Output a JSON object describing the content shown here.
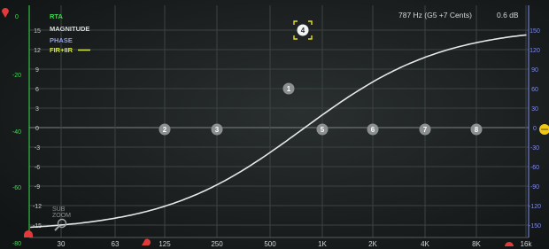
{
  "readout": {
    "frequency": "787 Hz (G5 +7 Cents)",
    "gain": "0.6 dB"
  },
  "legend": [
    {
      "label": "RTA",
      "color": "#35e04a"
    },
    {
      "label": "MAGNITUDE",
      "color": "#d8dcdc"
    },
    {
      "label": "PHASE",
      "color": "#8f9bf0"
    },
    {
      "label": "FIR+IIR",
      "color": "#d6e84a"
    }
  ],
  "rta_scale": {
    "values": [
      "0",
      "-20",
      "-40",
      "-60",
      "-80"
    ],
    "color": "#35e04a"
  },
  "magnitude_scale": {
    "values": [
      "15",
      "12",
      "9",
      "6",
      "3",
      "0",
      "-3",
      "-6",
      "-9",
      "-12",
      "-15"
    ],
    "color": "#c8cccc"
  },
  "phase_scale": {
    "values": [
      "150",
      "120",
      "90",
      "60",
      "30",
      "0",
      "-30",
      "-60",
      "-90",
      "-120",
      "-150"
    ],
    "color": "#7f8cf0"
  },
  "frequency_scale": {
    "values": [
      "30",
      "63",
      "125",
      "250",
      "500",
      "1K",
      "2K",
      "4K",
      "8K",
      "16k"
    ]
  },
  "sub_zoom": {
    "line1": "SUB",
    "line2": "ZOOM",
    "icon": "magnifier-icon"
  },
  "filter_nodes": [
    {
      "label": "1",
      "selected": false
    },
    {
      "label": "2",
      "selected": false
    },
    {
      "label": "3",
      "selected": false
    },
    {
      "label": "4",
      "selected": true
    },
    {
      "label": "5",
      "selected": false
    },
    {
      "label": "6",
      "selected": false
    },
    {
      "label": "7",
      "selected": false
    },
    {
      "label": "8",
      "selected": false
    }
  ],
  "colors": {
    "background": "#1a1e1e",
    "grid": "#3c4242",
    "zero_line": "#7c8282",
    "curve": "#e4e8e8",
    "node": "#8c9090",
    "handle_red": "#e23a3a",
    "handle_yellow": "#f0c814",
    "rta_axis": "#35e04a",
    "phase_axis": "#7f8cf0"
  }
}
